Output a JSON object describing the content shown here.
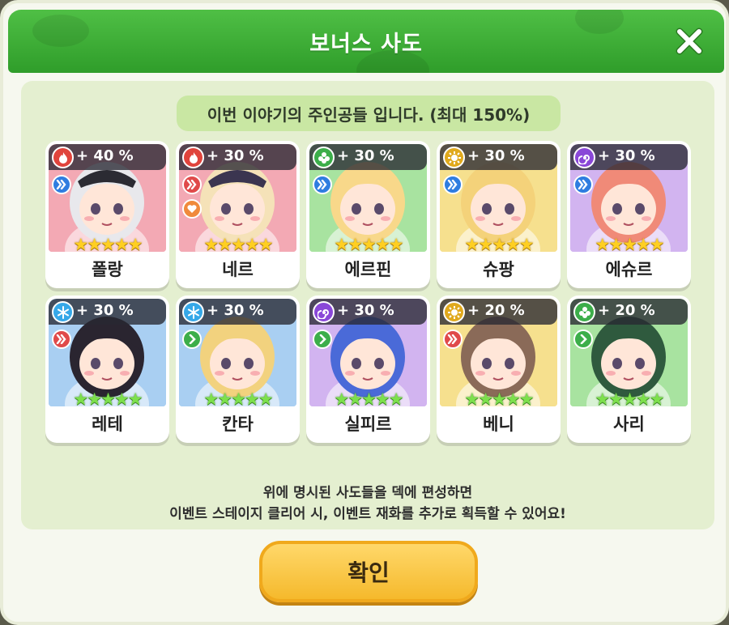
{
  "dialog": {
    "title": "보너스 사도",
    "close_icon": "close-icon",
    "header_text": "이번 이야기의 주인공들 입니다. (최대 150%)",
    "footer_line1": "위에 명시된 사도들을 덱에 편성하면",
    "footer_line2": "이벤트 스테이지 클리어 시, 이벤트 재화를 추가로 획득할 수 있어요!",
    "confirm_label": "확인"
  },
  "colors": {
    "title_green": "#3aae34",
    "panel_bg": "#e4efd0",
    "confirm_yellow": "#f9c843",
    "fire": "#e0443c",
    "nature": "#3cae4a",
    "light": "#e0a91c",
    "dark": "#8a48d8",
    "ice": "#36a8e8"
  },
  "characters": [
    {
      "name": "폴랑",
      "bonus": "+ 40 %",
      "element": "fire-icon",
      "element_color": "#e0443c",
      "role": "double-chevron-icon",
      "role_color": "#2f7de0",
      "role2": "",
      "bg": "#f3a9b4",
      "stars": 5,
      "star_color": "gold",
      "hair": "#e8e8ec",
      "cap": "#2b2b33"
    },
    {
      "name": "네르",
      "bonus": "+ 30 %",
      "element": "fire-icon",
      "element_color": "#e0443c",
      "role": "double-chevron-icon",
      "role_color": "#e04a4a",
      "role2": "heart-icon",
      "bg": "#f3a9b4",
      "stars": 5,
      "star_color": "gold",
      "hair": "#f5e2b8",
      "cap": "#3b3550"
    },
    {
      "name": "에르핀",
      "bonus": "+ 30 %",
      "element": "leaf-icon",
      "element_color": "#3cae4a",
      "role": "double-chevron-icon",
      "role_color": "#2f7de0",
      "role2": "",
      "bg": "#a8e3a0",
      "stars": 5,
      "star_color": "gold",
      "hair": "#f8d88a",
      "cap": ""
    },
    {
      "name": "슈팡",
      "bonus": "+ 30 %",
      "element": "sun-icon",
      "element_color": "#e0a91c",
      "role": "double-chevron-icon",
      "role_color": "#2f7de0",
      "role2": "",
      "bg": "#f6e08e",
      "stars": 5,
      "star_color": "gold",
      "hair": "#f4d27a",
      "cap": ""
    },
    {
      "name": "에슈르",
      "bonus": "+ 30 %",
      "element": "swirl-icon",
      "element_color": "#8a48d8",
      "role": "double-chevron-icon",
      "role_color": "#2f7de0",
      "role2": "",
      "bg": "#d2b4f0",
      "stars": 5,
      "star_color": "gold",
      "hair": "#f08a78",
      "cap": ""
    },
    {
      "name": "레테",
      "bonus": "+ 30 %",
      "element": "snowflake-icon",
      "element_color": "#36a8e8",
      "role": "double-chevron-icon",
      "role_color": "#e04a4a",
      "role2": "",
      "bg": "#a9cff2",
      "stars": 5,
      "star_color": "green",
      "hair": "#2a2530",
      "cap": ""
    },
    {
      "name": "칸타",
      "bonus": "+ 30 %",
      "element": "snowflake-icon",
      "element_color": "#36a8e8",
      "role": "single-chevron-icon",
      "role_color": "#3cae4a",
      "role2": "",
      "bg": "#a9cff2",
      "stars": 5,
      "star_color": "green",
      "hair": "#f2d27e",
      "cap": ""
    },
    {
      "name": "실피르",
      "bonus": "+ 30 %",
      "element": "swirl-icon",
      "element_color": "#8a48d8",
      "role": "single-chevron-icon",
      "role_color": "#3cae4a",
      "role2": "",
      "bg": "#d2b4f0",
      "stars": 5,
      "star_color": "green",
      "hair": "#4a6ad8",
      "cap": ""
    },
    {
      "name": "베니",
      "bonus": "+ 20 %",
      "element": "sun-icon",
      "element_color": "#e0a91c",
      "role": "double-chevron-icon",
      "role_color": "#e04a4a",
      "role2": "",
      "bg": "#f6e08e",
      "stars": 5,
      "star_color": "green",
      "hair": "#8a6a58",
      "cap": ""
    },
    {
      "name": "사리",
      "bonus": "+ 20 %",
      "element": "leaf-icon",
      "element_color": "#3cae4a",
      "role": "single-chevron-icon",
      "role_color": "#3cae4a",
      "role2": "",
      "bg": "#a8e3a0",
      "stars": 5,
      "star_color": "green",
      "hair": "#2f5a3e",
      "cap": ""
    }
  ]
}
